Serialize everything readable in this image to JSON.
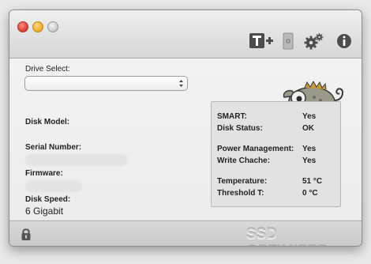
{
  "window": {
    "controls": [
      "close",
      "minimize",
      "zoom"
    ]
  },
  "toolbar": {
    "icons": [
      "text-size-icon",
      "drive-icon",
      "gear-icon",
      "info-icon"
    ]
  },
  "drive": {
    "label": "Drive Select:",
    "selected": ""
  },
  "disk_info": {
    "model_label": "Disk Model:",
    "serial_label": "Serial Number:",
    "firmware_label": "Firmware:",
    "speed_label": "Disk Speed:",
    "speed_value": "6 Gigabit"
  },
  "status": {
    "smart_label": "SMART:",
    "smart_value": "Yes",
    "disk_status_label": "Disk Status:",
    "disk_status_value": "OK",
    "power_label": "Power Management:",
    "power_value": "Yes",
    "write_label": "Write Chache:",
    "write_value": "Yes",
    "temp_label": "Temperature:",
    "temp_value": "51 °C",
    "threshold_label": "Threshold T:",
    "threshold_value": "0 °C"
  },
  "footer": {
    "brand": "SSD OPTIMIZER",
    "lock_icon": "lock-icon"
  },
  "colors": {
    "window_bg": "#ececec",
    "panel_bg": "#e2e2e2",
    "close": "#e0443b",
    "minimize": "#f1b02f"
  }
}
